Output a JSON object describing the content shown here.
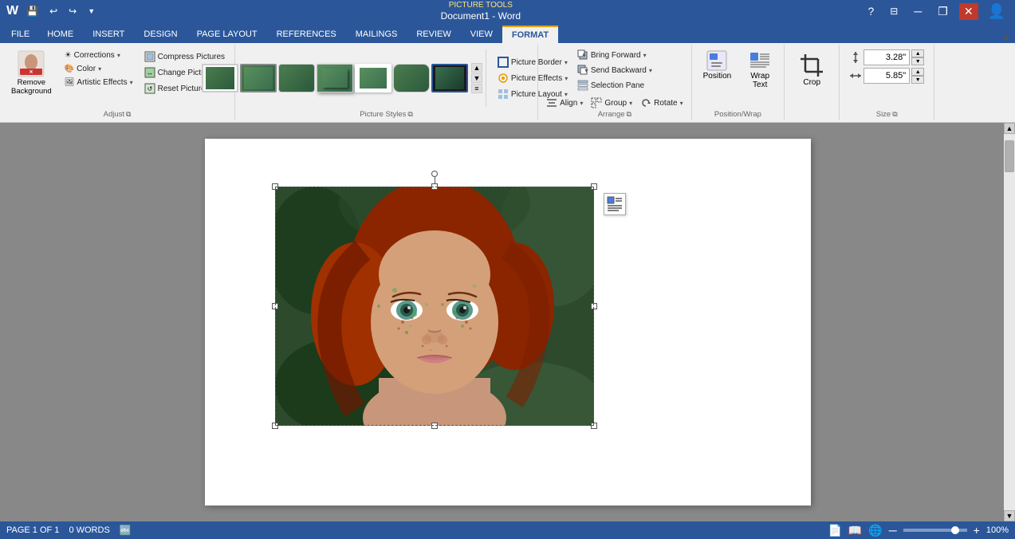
{
  "titlebar": {
    "title": "Document1 - Word",
    "picture_tools": "PICTURE TOOLS",
    "undo_label": "↩",
    "redo_label": "↪",
    "save_label": "💾",
    "help_btn": "?",
    "minimize": "─",
    "restore": "❐",
    "close": "✕",
    "ribbon_display": "⊟",
    "account_icon": "👤"
  },
  "tabs": [
    {
      "id": "file",
      "label": "FILE",
      "active": false
    },
    {
      "id": "home",
      "label": "HOME",
      "active": false
    },
    {
      "id": "insert",
      "label": "INSERT",
      "active": false
    },
    {
      "id": "design",
      "label": "DESIGN",
      "active": false
    },
    {
      "id": "pagelayout",
      "label": "PAGE LAYOUT",
      "active": false
    },
    {
      "id": "references",
      "label": "REFERENCES",
      "active": false
    },
    {
      "id": "mailings",
      "label": "MAILINGS",
      "active": false
    },
    {
      "id": "review",
      "label": "REVIEW",
      "active": false
    },
    {
      "id": "view",
      "label": "VIEW",
      "active": false
    },
    {
      "id": "format",
      "label": "FORMAT",
      "active": true
    }
  ],
  "ribbon": {
    "adjust": {
      "group_label": "Adjust",
      "remove_bg": "Remove\nBackground",
      "corrections": "Corrections",
      "color": "Color",
      "artistic_effects": "Artistic Effects",
      "compress_pictures": "Compress Pictures",
      "change_picture": "Change Picture",
      "reset_picture": "Reset Picture"
    },
    "picture_styles": {
      "group_label": "Picture Styles",
      "picture_border": "Picture Border",
      "picture_effects": "Picture Effects",
      "picture_layout": "Picture Layout"
    },
    "arrange": {
      "group_label": "Arrange",
      "bring_forward": "Bring Forward",
      "send_backward": "Send Backward",
      "selection_pane": "Selection Pane",
      "align": "Align",
      "group": "Group",
      "rotate": "Rotate"
    },
    "position_group": {
      "position_label": "Position",
      "wrap_text_label": "Wrap\nText",
      "crop_label": "Crop"
    },
    "size": {
      "group_label": "Size",
      "height_label": "3.28\"",
      "width_label": "5.85\""
    }
  },
  "document": {
    "image_alt": "Portrait of woman with freckles"
  },
  "statusbar": {
    "page_info": "PAGE 1 OF 1",
    "word_count": "0 WORDS",
    "zoom_level": "100%",
    "zoom_minus": "─",
    "zoom_plus": "+"
  }
}
